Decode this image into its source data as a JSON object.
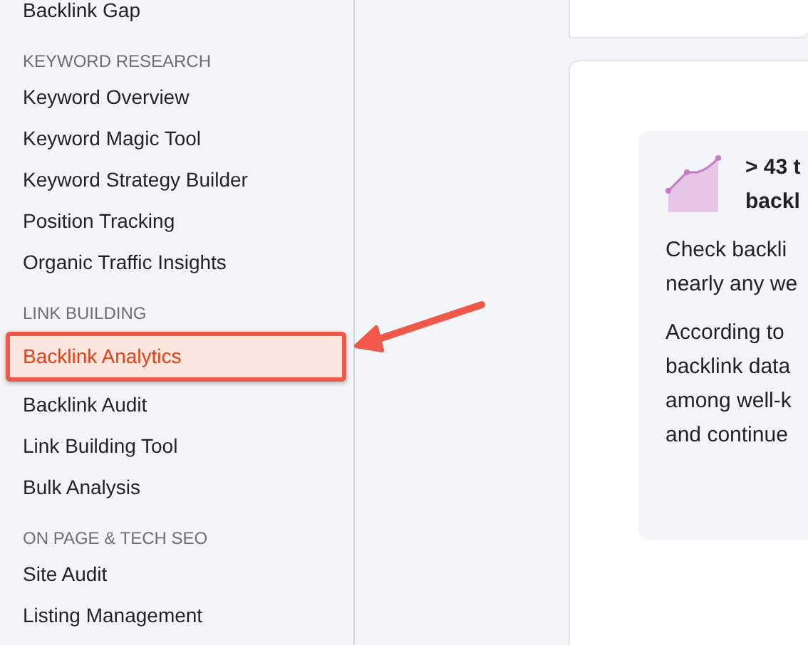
{
  "sidebar": {
    "top_item": {
      "label": "Backlink Gap",
      "selected": false
    },
    "sections": [
      {
        "title": "KEYWORD RESEARCH",
        "items": [
          {
            "label": "Keyword Overview",
            "selected": false
          },
          {
            "label": "Keyword Magic Tool",
            "selected": false
          },
          {
            "label": "Keyword Strategy Builder",
            "selected": false
          },
          {
            "label": "Position Tracking",
            "selected": false
          },
          {
            "label": "Organic Traffic Insights",
            "selected": false
          }
        ]
      },
      {
        "title": "LINK BUILDING",
        "items": [
          {
            "label": "Backlink Analytics",
            "selected": true
          },
          {
            "label": "Backlink Audit",
            "selected": false
          },
          {
            "label": "Link Building Tool",
            "selected": false
          },
          {
            "label": "Bulk Analysis",
            "selected": false
          }
        ]
      },
      {
        "title": "ON PAGE & TECH SEO",
        "items": [
          {
            "label": "Site Audit",
            "selected": false
          },
          {
            "label": "Listing Management",
            "selected": false
          }
        ]
      }
    ]
  },
  "info_card": {
    "heading_lines": [
      "> 43 t",
      "backl"
    ],
    "paragraphs": [
      [
        "Check backli",
        "nearly any we"
      ],
      [
        "According to",
        "backlink data",
        "among well-k",
        "and continue"
      ]
    ]
  }
}
